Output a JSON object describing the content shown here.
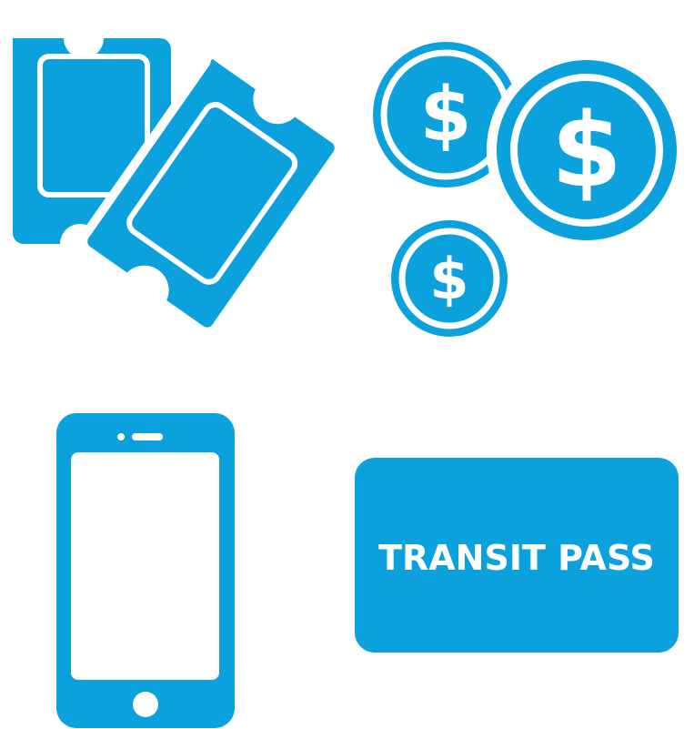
{
  "colors": {
    "primary": "#0aa1dd",
    "background": "#ffffff"
  },
  "icons": {
    "tickets": "tickets-icon",
    "coins": "coins-icon",
    "phone": "smartphone-icon",
    "pass_card": "transit-pass-card-icon"
  },
  "coins": {
    "symbol": "$"
  },
  "transit_pass": {
    "label": "TRANSIT PASS"
  }
}
